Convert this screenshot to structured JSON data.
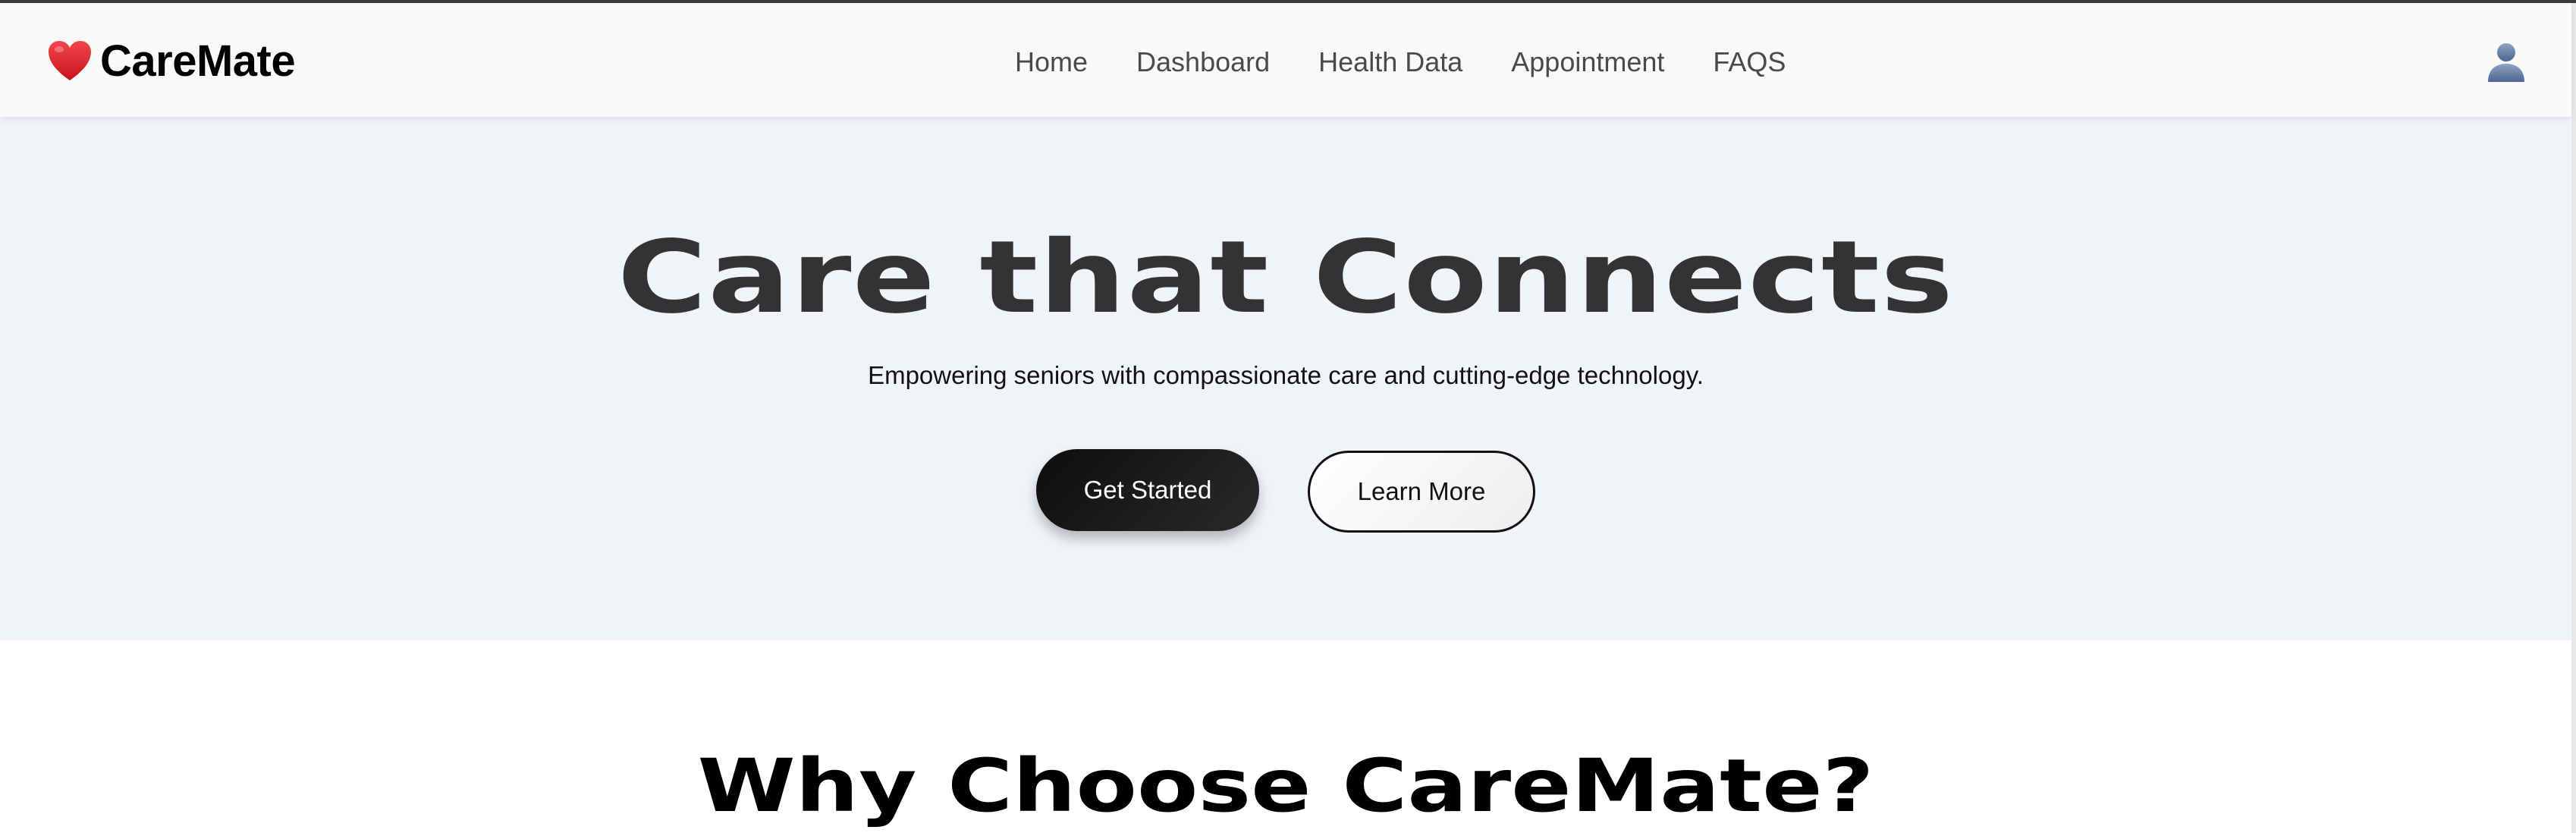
{
  "brand": {
    "name": "CareMate",
    "icon": "heart-icon",
    "icon_color": "#e0242c"
  },
  "nav": {
    "items": [
      {
        "label": "Home"
      },
      {
        "label": "Dashboard"
      },
      {
        "label": "Health Data"
      },
      {
        "label": "Appointment"
      },
      {
        "label": "FAQS"
      }
    ],
    "user_icon": "user-icon"
  },
  "hero": {
    "title": "Care that Connects",
    "subtitle": "Empowering seniors with compassionate care and cutting-edge technology.",
    "primary_button": "Get Started",
    "secondary_button": "Learn More",
    "background": "#f0f3f8"
  },
  "section": {
    "title": "Why Choose CareMate?"
  }
}
